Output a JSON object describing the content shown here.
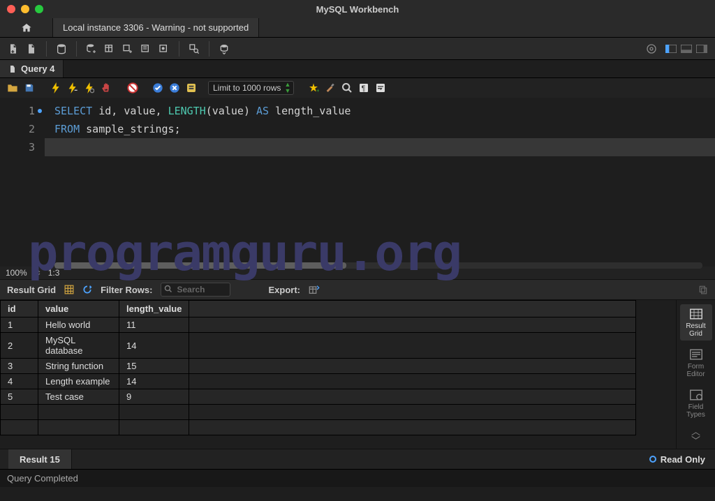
{
  "window": {
    "title": "MySQL Workbench"
  },
  "conn": {
    "tab": "Local instance 3306 - Warning - not supported"
  },
  "query_tab": {
    "label": "Query 4"
  },
  "editor": {
    "limit_label": "Limit to 1000 rows",
    "zoom": "100%",
    "cursor": "1:3"
  },
  "sql": {
    "line1_select": "SELECT",
    "line1_cols": " id, value, ",
    "line1_length": "LENGTH",
    "line1_paren_open": "(",
    "line1_arg": "value",
    "line1_paren_close": ") ",
    "line1_as": "AS",
    "line1_alias": " length_value",
    "line2_from": "FROM",
    "line2_tbl": " sample_strings;"
  },
  "watermark": "programguru.org",
  "results": {
    "grid_label": "Result Grid",
    "filter_label": "Filter Rows:",
    "search_placeholder": "Search",
    "export_label": "Export:",
    "columns": [
      "id",
      "value",
      "length_value"
    ],
    "rows": [
      [
        "1",
        "Hello world",
        "11"
      ],
      [
        "2",
        "MySQL database",
        "14"
      ],
      [
        "3",
        "String function",
        "15"
      ],
      [
        "4",
        "Length example",
        "14"
      ],
      [
        "5",
        "Test case",
        "9"
      ]
    ],
    "tab": "Result 15",
    "read_only": "Read Only"
  },
  "side": {
    "result_grid": "Result Grid",
    "form_editor": "Form Editor",
    "field_types": "Field Types"
  },
  "status": {
    "text": "Query Completed"
  }
}
